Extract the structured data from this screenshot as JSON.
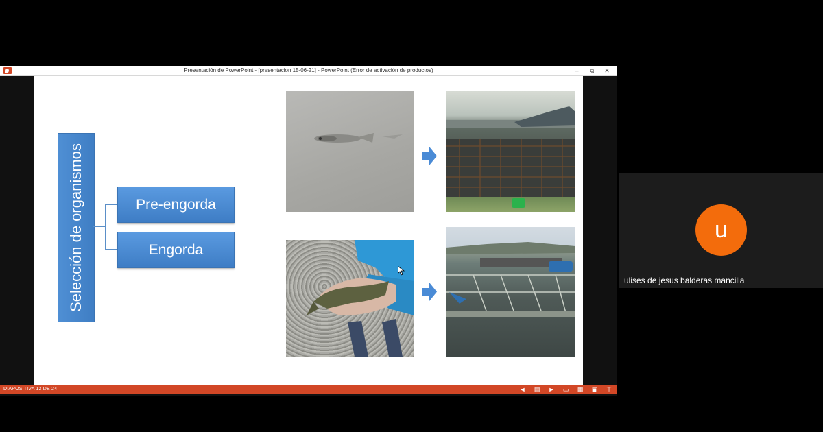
{
  "window": {
    "title": "Presentación de PowerPoint - [presentacion 15-06-21] - PowerPoint (Error de activación de productos)",
    "controls": {
      "minimize": "–",
      "restore": "⧉",
      "close": "✕"
    }
  },
  "slide": {
    "main_label": "Selección de organismos",
    "branches": [
      "Pre-engorda",
      "Engorda"
    ]
  },
  "statusbar": {
    "slide_counter": "DIAPOSITIVA 12 DE 24",
    "icons": [
      "prev-icon",
      "notes-icon",
      "next-icon",
      "normal-view-icon",
      "sorter-view-icon",
      "reading-view-icon",
      "slideshow-icon"
    ]
  },
  "participant": {
    "initial": "u",
    "name": "ulises de jesus balderas mancilla",
    "avatar_color": "#f36c0c"
  },
  "colors": {
    "ppt_accent": "#d24726",
    "smartart_blue": "#4a8bd6"
  }
}
